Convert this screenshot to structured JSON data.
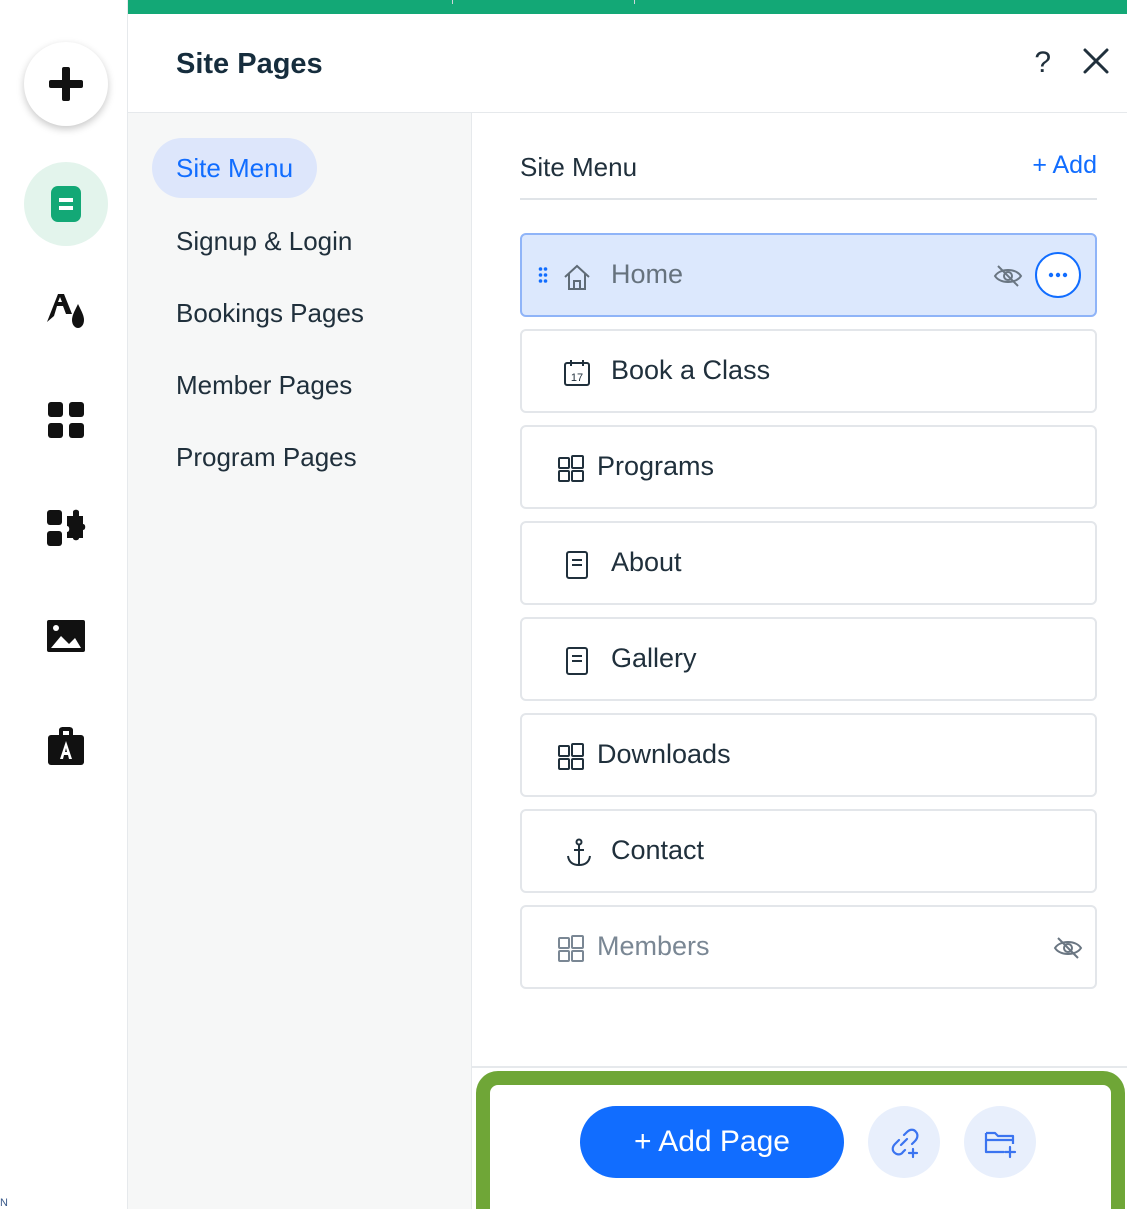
{
  "rail": {
    "items": [
      {
        "name": "add-elements",
        "icon": "plus-icon"
      },
      {
        "name": "pages",
        "icon": "page-icon"
      },
      {
        "name": "design",
        "icon": "theme-icon"
      },
      {
        "name": "apps",
        "icon": "apps-grid-icon"
      },
      {
        "name": "business-tools",
        "icon": "puzzle-icon"
      },
      {
        "name": "media",
        "icon": "image-icon"
      },
      {
        "name": "portfolio",
        "icon": "briefcase-icon"
      }
    ],
    "corner_glyph": "N"
  },
  "header": {
    "title": "Site Pages",
    "help_label": "?"
  },
  "categories": [
    {
      "label": "Site Menu",
      "active": true
    },
    {
      "label": "Signup & Login",
      "active": false
    },
    {
      "label": "Bookings Pages",
      "active": false
    },
    {
      "label": "Member Pages",
      "active": false
    },
    {
      "label": "Program Pages",
      "active": false
    }
  ],
  "panel": {
    "title": "Site Menu",
    "add_label": "+ Add"
  },
  "pages": [
    {
      "label": "Home",
      "icon": "home-icon",
      "selected": true,
      "hidden": true
    },
    {
      "label": "Book a Class",
      "icon": "calendar-icon",
      "selected": false,
      "hidden": false
    },
    {
      "label": "Programs",
      "icon": "app-page-icon",
      "selected": false,
      "hidden": false
    },
    {
      "label": "About",
      "icon": "document-icon",
      "selected": false,
      "hidden": false
    },
    {
      "label": "Gallery",
      "icon": "document-icon",
      "selected": false,
      "hidden": false
    },
    {
      "label": "Downloads",
      "icon": "app-page-icon",
      "selected": false,
      "hidden": false
    },
    {
      "label": "Contact",
      "icon": "anchor-icon",
      "selected": false,
      "hidden": false
    },
    {
      "label": "Members",
      "icon": "app-page-icon",
      "selected": false,
      "hidden": true
    }
  ],
  "footer": {
    "add_page_label": "+ Add Page",
    "link_button_icon": "add-link-icon",
    "folder_button_icon": "add-folder-icon"
  },
  "colors": {
    "accent_green": "#13a876",
    "highlight_frame": "#6fa637",
    "primary_blue": "#116dff",
    "selected_bg": "#dce8fd"
  }
}
